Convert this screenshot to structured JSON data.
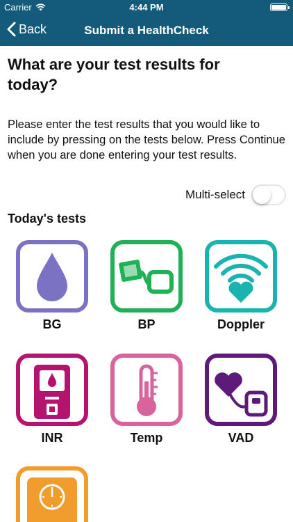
{
  "status_bar": {
    "carrier": "Carrier",
    "time": "4:44 PM",
    "wifi_icon": "wifi-icon",
    "battery_icon": "battery-icon"
  },
  "nav": {
    "back_label": "Back",
    "title": "Submit a HealthCheck"
  },
  "heading": "What are your test results for today?",
  "instructions": "Please enter the test results that you would like to include by pressing on the tests below.  Press Continue when you are done entering your test results.",
  "multi_select": {
    "label": "Multi-select",
    "on": false
  },
  "section_title": "Today's tests",
  "tests": [
    {
      "label": "BG",
      "icon": "blood-drop-icon",
      "color": "#7b72c4"
    },
    {
      "label": "BP",
      "icon": "blood-pressure-cuff-icon",
      "color": "#1fb155"
    },
    {
      "label": "Doppler",
      "icon": "doppler-heart-icon",
      "color": "#1ab3b0"
    },
    {
      "label": "INR",
      "icon": "inr-meter-icon",
      "color": "#b4146e"
    },
    {
      "label": "Temp",
      "icon": "thermometer-icon",
      "color": "#d9639c"
    },
    {
      "label": "VAD",
      "icon": "vad-device-icon",
      "color": "#5e1a7a"
    },
    {
      "label": "",
      "icon": "scale-icon",
      "color": "#f09d2e"
    }
  ]
}
